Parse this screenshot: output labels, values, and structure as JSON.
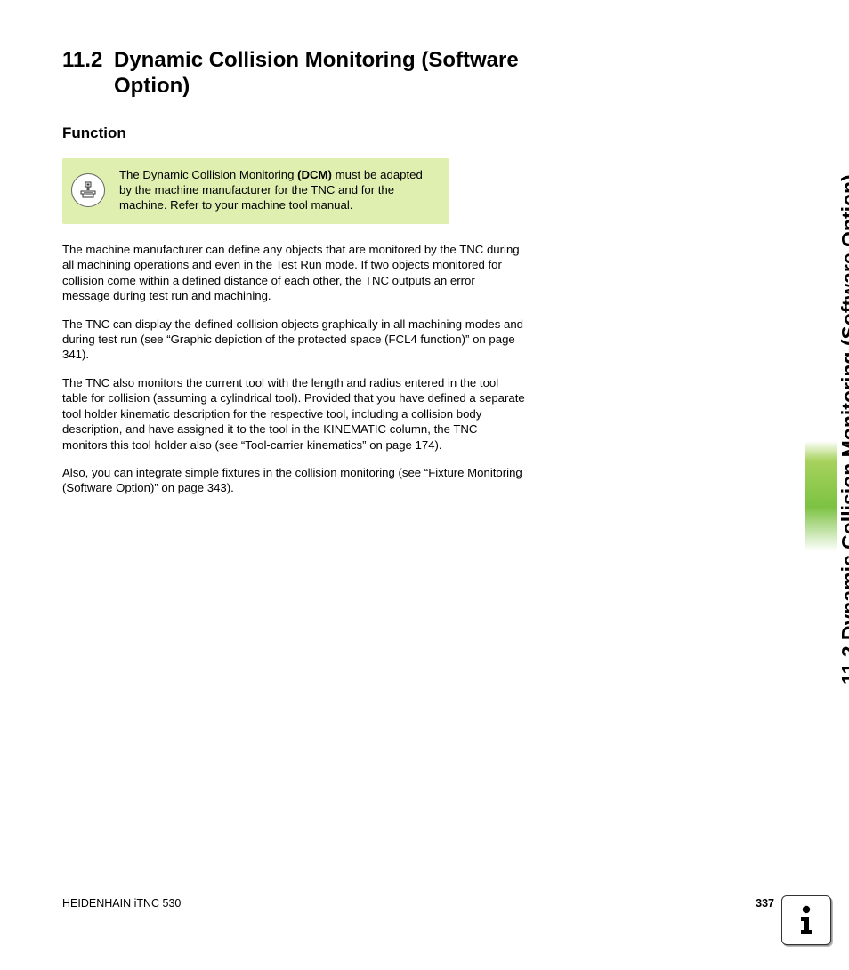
{
  "heading": {
    "number": "11.2",
    "title": "Dynamic Collision Monitoring (Software Option)"
  },
  "subheading": "Function",
  "note": {
    "pre": "The Dynamic Collision Monitoring ",
    "bold": "(DCM)",
    "post": " must be adapted by the machine manufacturer for the TNC and for the machine. Refer to your machine tool manual."
  },
  "paragraphs": [
    "The machine manufacturer can define any objects that are monitored by the TNC during all machining operations and even in the Test Run mode. If two objects monitored for collision come within a defined distance of each other, the TNC outputs an error message during test run and machining.",
    "The TNC can display the defined collision objects graphically in all machining modes and during test run (see “Graphic depiction of the protected space (FCL4 function)” on page 341).",
    "The TNC also monitors the current tool with the length and radius entered in the tool table for collision (assuming a cylindrical tool). Provided that you have defined a separate tool holder kinematic description for the respective tool, including a collision body description, and have assigned it to the tool in the KINEMATIC column, the TNC monitors this tool holder also (see “Tool-carrier kinematics” on page 174).",
    "Also, you can integrate simple fixtures in the collision monitoring (see “Fixture Monitoring (Software Option)” on page 343)."
  ],
  "sideTab": "11.2 Dynamic Collision Monitoring (Software Option)",
  "footer": {
    "left": "HEIDENHAIN iTNC 530",
    "page": "337"
  }
}
